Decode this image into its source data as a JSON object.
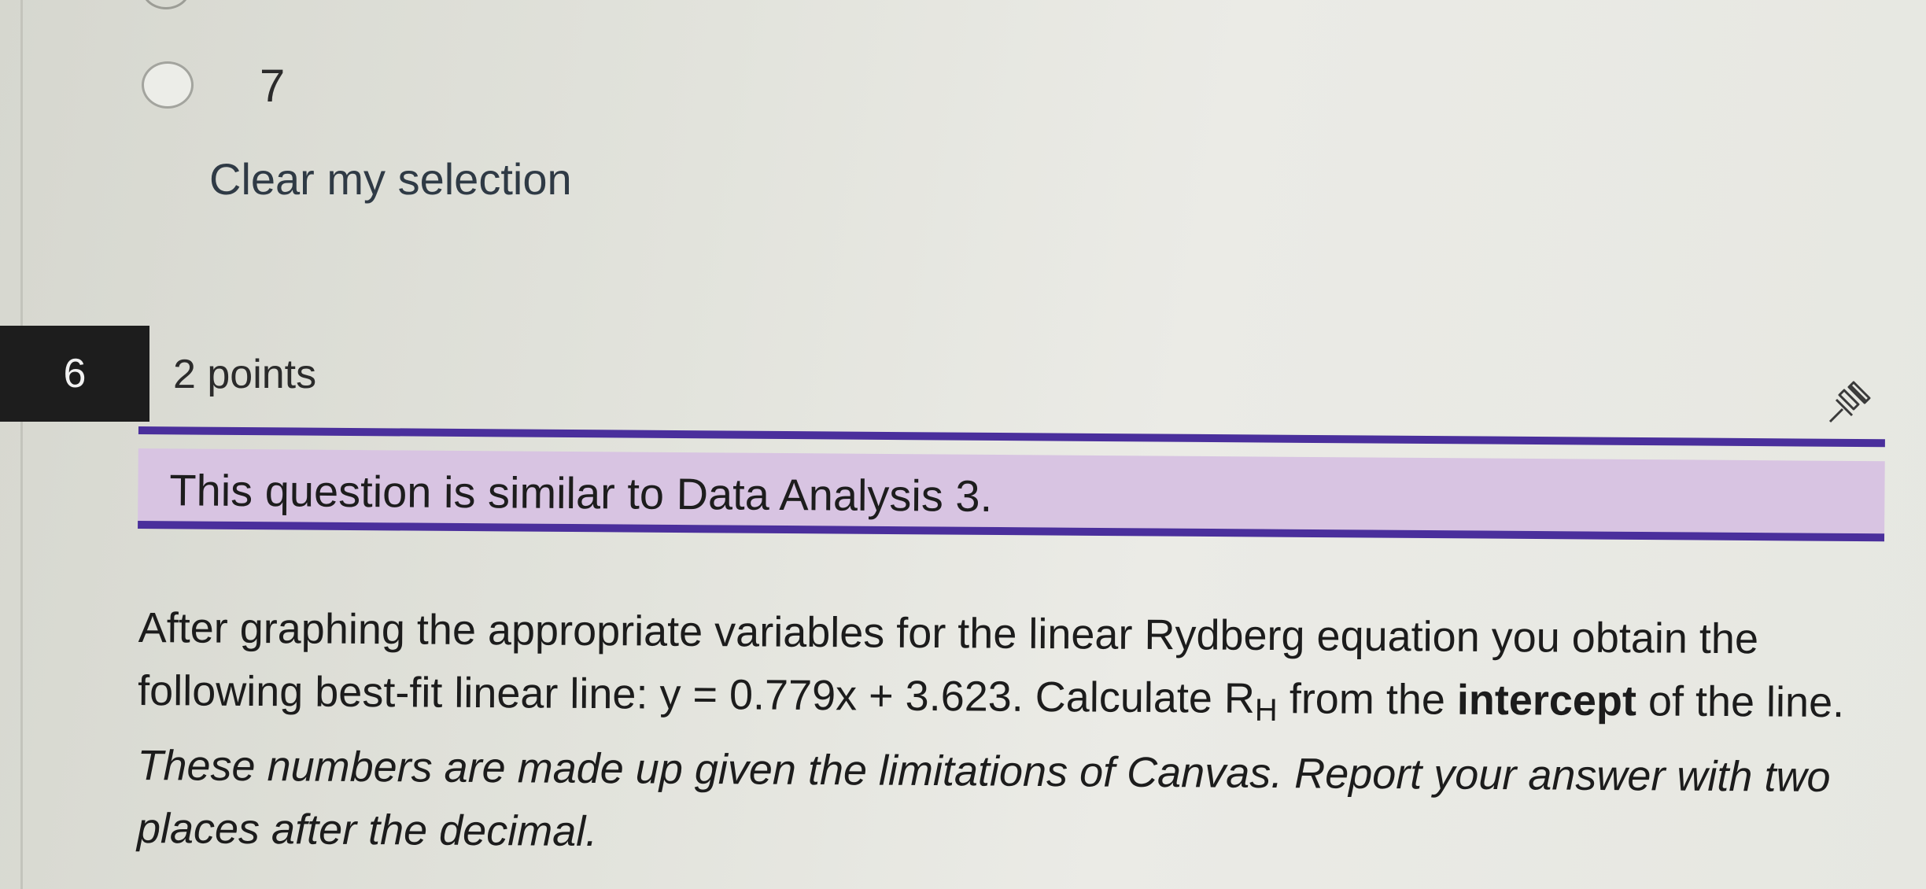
{
  "previous_question": {
    "option_label": "7",
    "clear_label": "Clear my selection"
  },
  "question": {
    "number": "6",
    "points": "2 points",
    "callout": "This question is similar to Data Analysis 3.",
    "text": {
      "part1": "After graphing the appropriate variables for the linear Rydberg equation you obtain the following best-fit linear line: y = 0.779x + 3.623. Calculate R",
      "subscript": "H",
      "part2": " from the ",
      "bold": "intercept",
      "part3": " of the line. ",
      "italic": "These numbers are made up given the limitations of Canvas. Report your answer with two places after the decimal."
    }
  },
  "icons": {
    "flag": "pin-icon"
  }
}
